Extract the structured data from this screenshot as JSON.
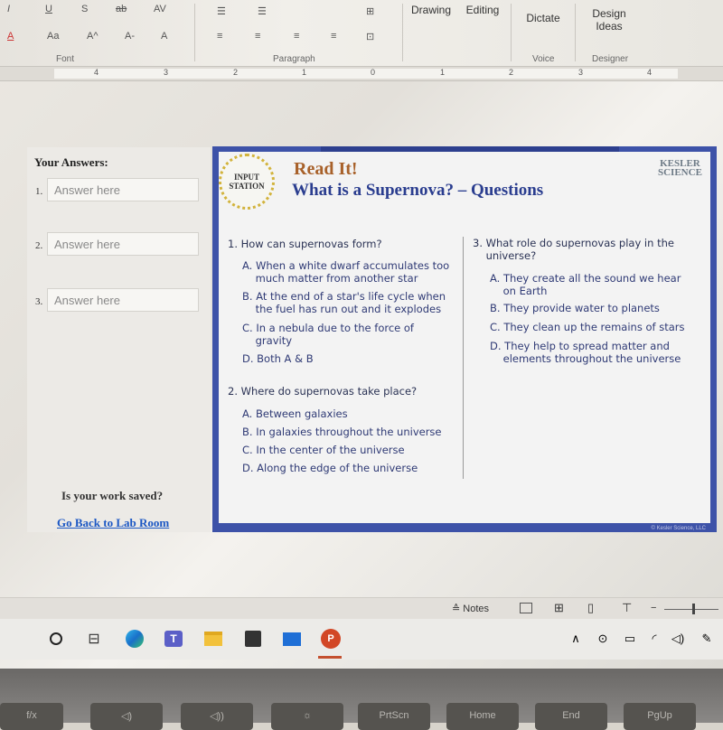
{
  "ribbon": {
    "font_row1": [
      "I",
      "U",
      "S",
      "ab",
      "AV"
    ],
    "font_row2": [
      "A",
      "Aa",
      "A^",
      "A-",
      "A"
    ],
    "font_group": "Font",
    "paragraph_group": "Paragraph",
    "drawing": "Drawing",
    "editing": "Editing",
    "dictate": "Dictate",
    "design_ideas": [
      "Design",
      "Ideas"
    ],
    "voice_group": "Voice",
    "designer_group": "Designer"
  },
  "ruler": [
    "4",
    "3",
    "2",
    "1",
    "0",
    "1",
    "2",
    "3",
    "4"
  ],
  "left_panel": {
    "heading": "Your Answers:",
    "answers": [
      {
        "num": "1.",
        "placeholder": "Answer here"
      },
      {
        "num": "2.",
        "placeholder": "Answer here"
      },
      {
        "num": "3.",
        "placeholder": "Answer here"
      }
    ],
    "saved_question": "Is your work saved?",
    "back_link": "Go Back to Lab Room"
  },
  "slide": {
    "badge": [
      "INPUT",
      "STATION"
    ],
    "title1": "Read It!",
    "title2": "What is a Supernova? – Questions",
    "brand": [
      "KESLER",
      "SCIENCE"
    ],
    "copyright": "© Kesler Science, LLC",
    "questions": [
      {
        "text": [
          "1. How can supernovas form?"
        ],
        "options": [
          [
            "A. When a white dwarf accumulates too",
            "much matter from another star"
          ],
          [
            "B. At the end of a star's life cycle when",
            "the fuel has run out and it explodes"
          ],
          [
            "C. In a nebula due to the force of",
            "gravity"
          ],
          [
            "D. Both A & B"
          ]
        ]
      },
      {
        "text": [
          "2. Where do supernovas take place?"
        ],
        "options": [
          [
            "A. Between galaxies"
          ],
          [
            "B. In galaxies throughout the universe"
          ],
          [
            "C. In the center of the universe"
          ],
          [
            "D. Along the edge of the universe"
          ]
        ]
      },
      {
        "text": [
          "3. What role do supernovas play in the",
          "universe?"
        ],
        "options": [
          [
            "A. They create all the sound we hear",
            "on Earth"
          ],
          [
            "B. They provide water to planets"
          ],
          [
            "C. They clean up the remains of stars"
          ],
          [
            "D. They help to spread matter and",
            "elements throughout the universe"
          ]
        ]
      }
    ]
  },
  "statusbar": {
    "notes": "Notes"
  },
  "taskbar": {
    "apps": [
      "start",
      "task-view",
      "edge",
      "teams",
      "file-explorer",
      "store",
      "mail",
      "powerpoint"
    ]
  },
  "keyboard": {
    "keys": [
      "f/x",
      "◁)",
      "◁))",
      "☼",
      "PrtScn",
      "Home",
      "End",
      "PgUp"
    ]
  }
}
